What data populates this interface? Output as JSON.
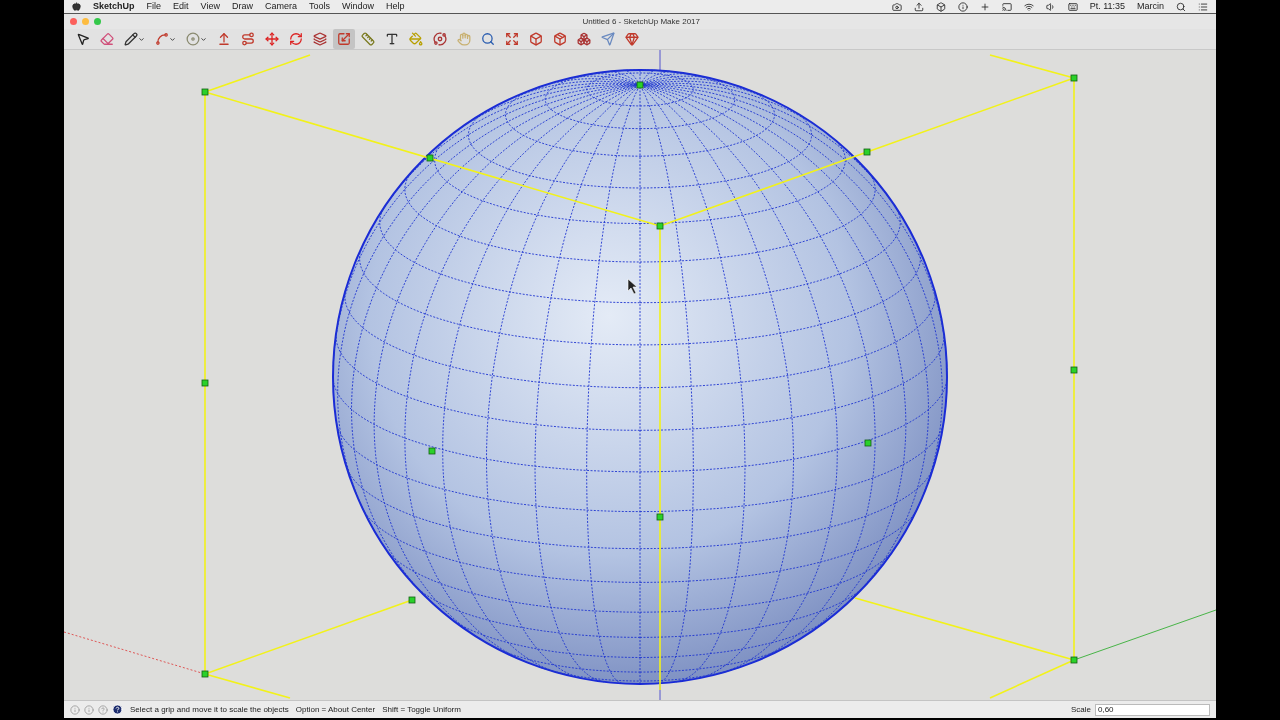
{
  "menu_bar": {
    "app_name": "SketchUp",
    "menus": [
      "File",
      "Edit",
      "View",
      "Draw",
      "Camera",
      "Tools",
      "Window",
      "Help"
    ],
    "clock": "Pt. 11:35",
    "user": "Marcin"
  },
  "window": {
    "title": "Untitled 6 - SketchUp Make 2017"
  },
  "toolbar": {
    "tools": [
      {
        "selected": false,
        "dropdown": false
      },
      {
        "selected": false,
        "dropdown": false
      },
      {
        "selected": false,
        "dropdown": true
      },
      {
        "selected": false,
        "dropdown": true
      },
      {
        "selected": false,
        "dropdown": true
      },
      {
        "selected": false,
        "dropdown": false
      },
      {
        "selected": false,
        "dropdown": false
      },
      {
        "selected": false,
        "dropdown": false
      },
      {
        "selected": false,
        "dropdown": false
      },
      {
        "selected": false,
        "dropdown": false
      },
      {
        "selected": true,
        "dropdown": false
      },
      {
        "selected": false,
        "dropdown": false
      },
      {
        "selected": false,
        "dropdown": false
      },
      {
        "selected": false,
        "dropdown": false
      },
      {
        "selected": false,
        "dropdown": false
      },
      {
        "selected": false,
        "dropdown": false
      },
      {
        "selected": false,
        "dropdown": false
      },
      {
        "selected": false,
        "dropdown": false
      },
      {
        "selected": false,
        "dropdown": false
      },
      {
        "selected": false,
        "dropdown": false
      },
      {
        "selected": false,
        "dropdown": false
      },
      {
        "selected": false,
        "dropdown": false
      },
      {
        "selected": false,
        "dropdown": false
      }
    ]
  },
  "status_bar": {
    "hints": [
      "Select a grip and move it to scale the objects",
      "Option = About Center",
      "Shift = Toggle Uniform"
    ],
    "measurement_label": "Scale",
    "measurement_value": "0,60"
  }
}
